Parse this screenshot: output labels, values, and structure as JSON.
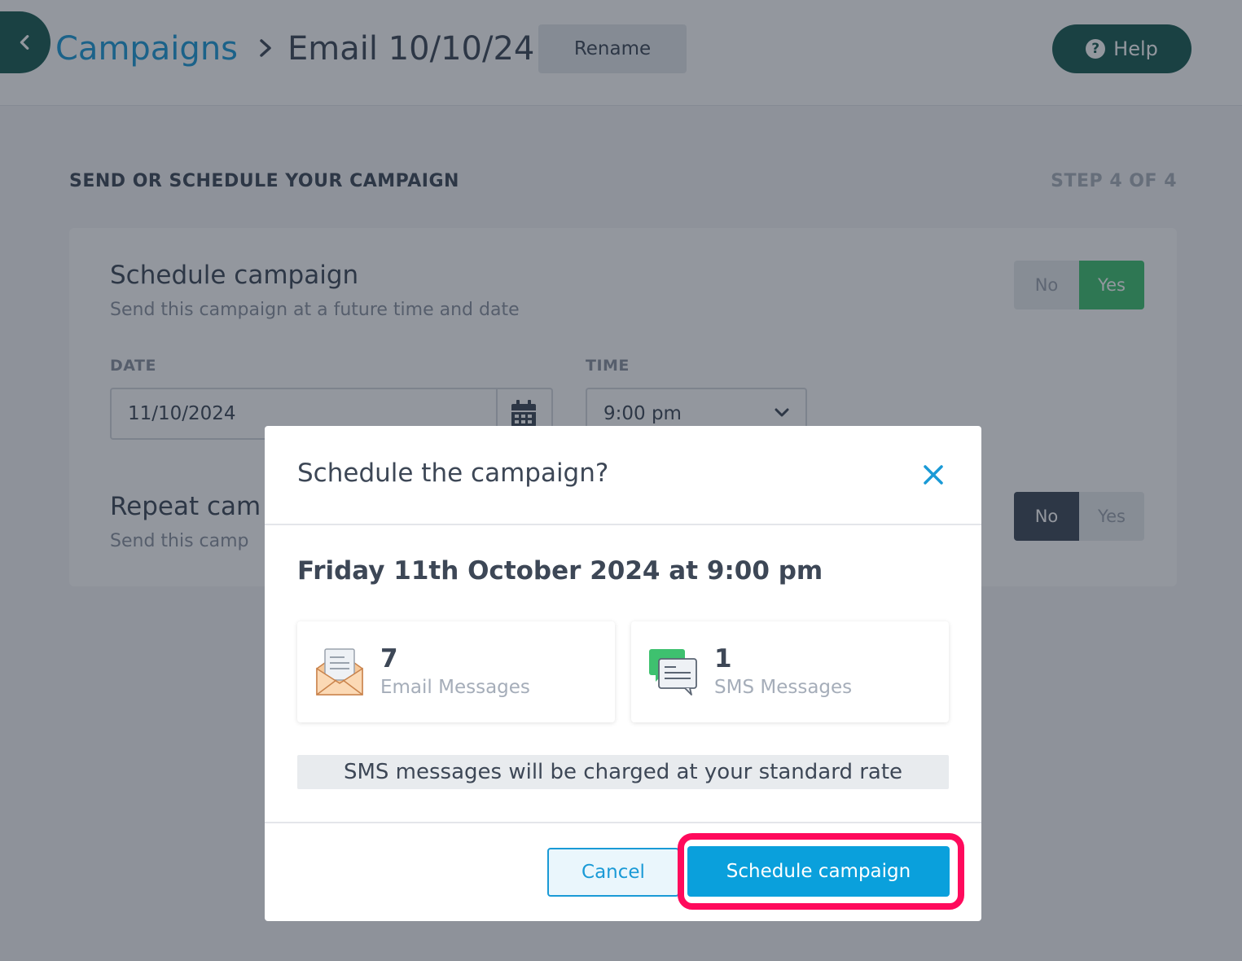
{
  "header": {
    "breadcrumb_root": "Campaigns",
    "breadcrumb_current": "Email 10/10/24",
    "rename_label": "Rename",
    "help_label": "Help"
  },
  "page": {
    "section_title": "SEND OR SCHEDULE YOUR CAMPAIGN",
    "step_label": "STEP 4 OF 4"
  },
  "schedule": {
    "title": "Schedule campaign",
    "subtitle": "Send this campaign at a future time and date",
    "toggle_no": "No",
    "toggle_yes": "Yes",
    "toggle_selected": "Yes",
    "date_label": "DATE",
    "date_value": "11/10/2024",
    "time_label": "TIME",
    "time_value": "9:00 pm"
  },
  "repeat": {
    "title": "Repeat cam",
    "subtitle": "Send this camp",
    "toggle_no": "No",
    "toggle_yes": "Yes",
    "toggle_selected": "No"
  },
  "modal": {
    "title": "Schedule the campaign?",
    "when": "Friday 11th October 2024 at 9:00 pm",
    "email_count": "7",
    "email_label": "Email Messages",
    "sms_count": "1",
    "sms_label": "SMS Messages",
    "notice": "SMS messages will be charged at your standard rate",
    "cancel_label": "Cancel",
    "confirm_label": "Schedule campaign"
  },
  "colors": {
    "brand_dark": "#185a52",
    "accent_blue": "#0aa0dc",
    "toggle_green": "#3ec16f",
    "highlight": "#ff0a5c"
  },
  "icons": {
    "back": "chevron-left-icon",
    "breadcrumb_separator": "chevron-right-icon",
    "help": "question-circle-icon",
    "calendar": "calendar-icon",
    "dropdown": "chevron-down-icon",
    "close": "close-icon",
    "email": "envelope-icon",
    "sms": "chat-bubbles-icon"
  }
}
